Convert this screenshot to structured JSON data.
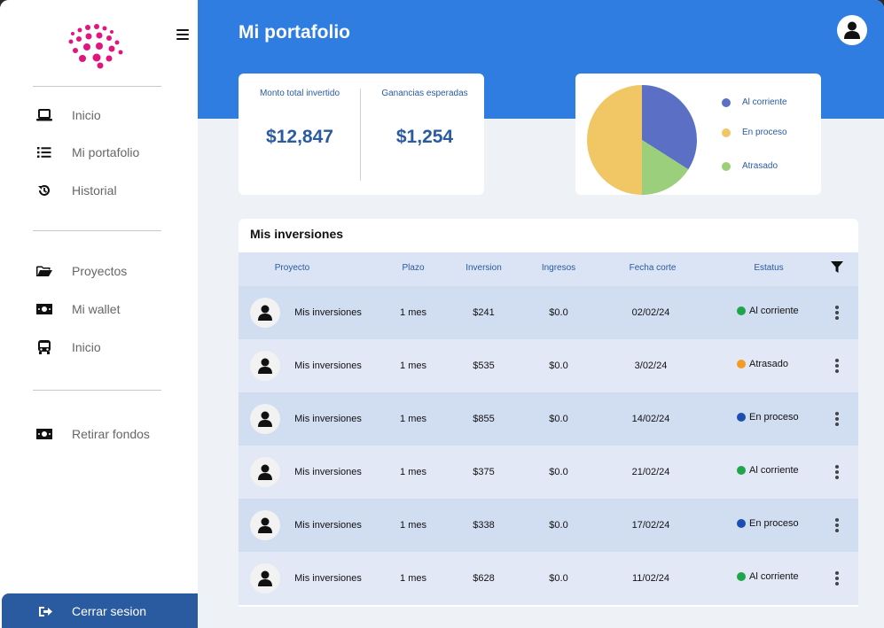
{
  "sidebar": {
    "nav_group_1": [
      {
        "label": "Inicio",
        "icon": "laptop-icon"
      },
      {
        "label": "Mi portafolio",
        "icon": "list-icon"
      },
      {
        "label": "Historial",
        "icon": "history-icon"
      }
    ],
    "nav_group_2": [
      {
        "label": "Proyectos",
        "icon": "folder-open-icon"
      },
      {
        "label": "Mi wallet",
        "icon": "money-bill-icon"
      },
      {
        "label": "Inicio",
        "icon": "bus-icon"
      }
    ],
    "nav_group_3": [
      {
        "label": "Retirar fondos",
        "icon": "money-bill-icon"
      }
    ],
    "logout_label": "Cerrar sesion"
  },
  "header": {
    "title": "Mi portafolio"
  },
  "stats": {
    "total_label": "Monto total invertido",
    "total_value": "$12,847",
    "gains_label": "Ganancias esperadas",
    "gains_value": "$1,254"
  },
  "chart_data": {
    "type": "pie",
    "slices": [
      {
        "label": "Al corriente",
        "value": 34,
        "color": "#5b70c4"
      },
      {
        "label": "Atrasado",
        "value": 16,
        "color": "#9ccf7b"
      },
      {
        "label": "En proceso",
        "value": 50,
        "color": "#f1c766"
      }
    ],
    "legend": [
      "Al corriente",
      "En proceso",
      "Atrasado"
    ],
    "legend_placement": "right"
  },
  "table": {
    "title": "Mis inversiones",
    "columns": [
      "Proyecto",
      "Plazo",
      "Inversion",
      "Ingresos",
      "Fecha corte",
      "Estatus"
    ],
    "rows": [
      {
        "project": "Mis inversiones",
        "term": "1 mes",
        "investment": "$241",
        "income": "$0.0",
        "date": "02/02/24",
        "status": "Al corriente",
        "status_color": "#1fa64a"
      },
      {
        "project": "Mis inversiones",
        "term": "1 mes",
        "investment": "$535",
        "income": "$0.0",
        "date": "3/02/24",
        "status": "Atrasado",
        "status_color": "#f59a23"
      },
      {
        "project": "Mis inversiones",
        "term": "1 mes",
        "investment": "$855",
        "income": "$0.0",
        "date": "14/02/24",
        "status": "En proceso",
        "status_color": "#1d4fb0"
      },
      {
        "project": "Mis inversiones",
        "term": "1 mes",
        "investment": "$375",
        "income": "$0.0",
        "date": "21/02/24",
        "status": "Al corriente",
        "status_color": "#1fa64a"
      },
      {
        "project": "Mis inversiones",
        "term": "1 mes",
        "investment": "$338",
        "income": "$0.0",
        "date": "17/02/24",
        "status": "En proceso",
        "status_color": "#1d4fb0"
      },
      {
        "project": "Mis inversiones",
        "term": "1 mes",
        "investment": "$628",
        "income": "$0.0",
        "date": "11/02/24",
        "status": "Al corriente",
        "status_color": "#1fa64a"
      }
    ]
  },
  "colors": {
    "brand_blue": "#2f7de1",
    "dark_blue": "#2a5aa0",
    "logo_magenta": "#e0157e"
  }
}
